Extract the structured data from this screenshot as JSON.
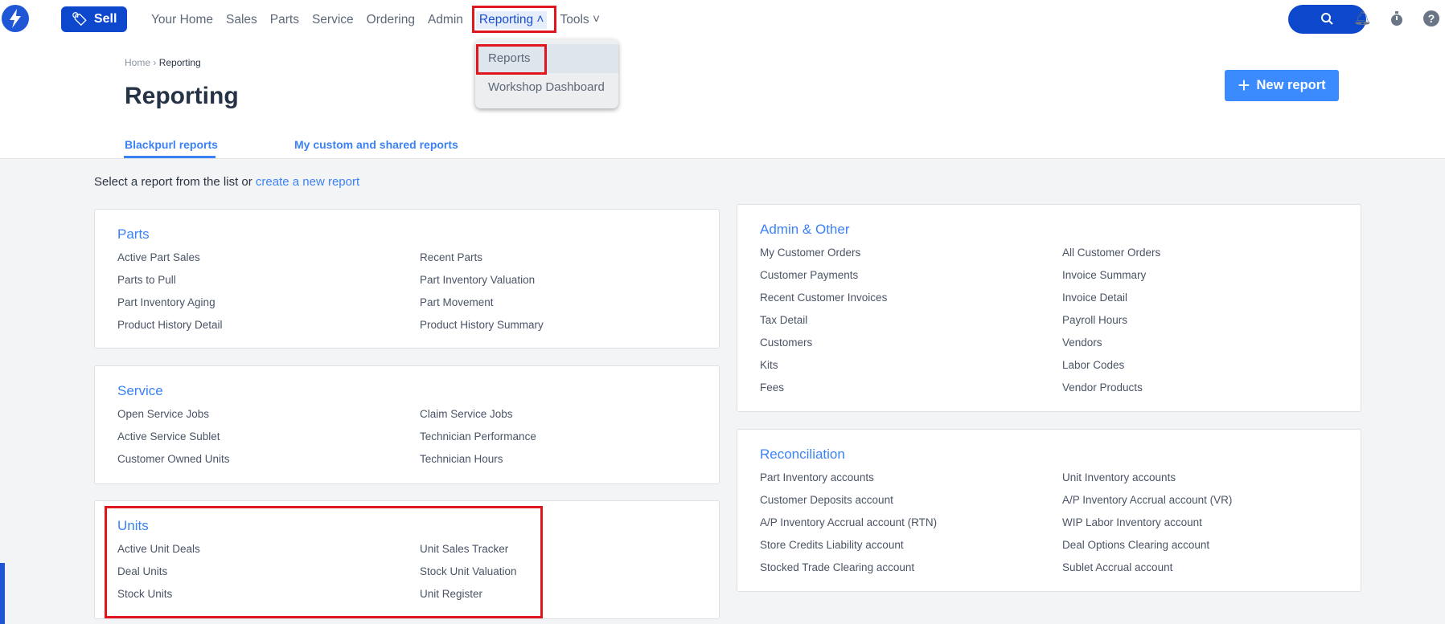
{
  "topbar": {
    "sell_label": "Sell",
    "nav": [
      "Your Home",
      "Sales",
      "Parts",
      "Service",
      "Ordering",
      "Admin",
      "Reporting",
      "Tools"
    ],
    "active": "Reporting"
  },
  "dropdown": {
    "items": [
      "Reports",
      "Workshop Dashboard"
    ],
    "selected": "Reports"
  },
  "breadcrumb": {
    "home": "Home",
    "sep": "›",
    "current": "Reporting"
  },
  "page_title": "Reporting",
  "new_report_label": "New report",
  "tabs": [
    "Blackpurl reports",
    "My custom and shared reports"
  ],
  "intro": {
    "text": "Select a report from the list or ",
    "link": "create a new report"
  },
  "cards": [
    {
      "title": "Parts",
      "items": [
        "Active Part Sales",
        "Recent Parts",
        "Parts to Pull",
        "Part Inventory Valuation",
        "Part Inventory Aging",
        "Part Movement",
        "Product History Detail",
        "Product History Summary"
      ]
    },
    {
      "title": "Service",
      "items": [
        "Open Service Jobs",
        "Claim Service Jobs",
        "Active Service Sublet",
        "Technician Performance",
        "Customer Owned Units",
        "Technician Hours"
      ]
    },
    {
      "title": "Units",
      "items": [
        "Active Unit Deals",
        "Unit Sales Tracker",
        "Deal Units",
        "Stock Unit Valuation",
        "Stock Units",
        "Unit Register"
      ]
    },
    {
      "title": "Admin & Other",
      "items": [
        "My Customer Orders",
        "All Customer Orders",
        "Customer Payments",
        "Invoice Summary",
        "Recent Customer Invoices",
        "Invoice Detail",
        "Tax Detail",
        "Payroll Hours",
        "Customers",
        "Vendors",
        "Kits",
        "Labor Codes",
        "Fees",
        "Vendor Products"
      ]
    },
    {
      "title": "Reconciliation",
      "items": [
        "Part Inventory accounts",
        "Unit Inventory accounts",
        "Customer Deposits account",
        "A/P Inventory Accrual account (VR)",
        "A/P Inventory Accrual account (RTN)",
        "WIP Labor Inventory account",
        "Store Credits Liability account",
        "Deal Options Clearing account",
        "Stocked Trade Clearing account",
        "Sublet Accrual account"
      ]
    }
  ]
}
